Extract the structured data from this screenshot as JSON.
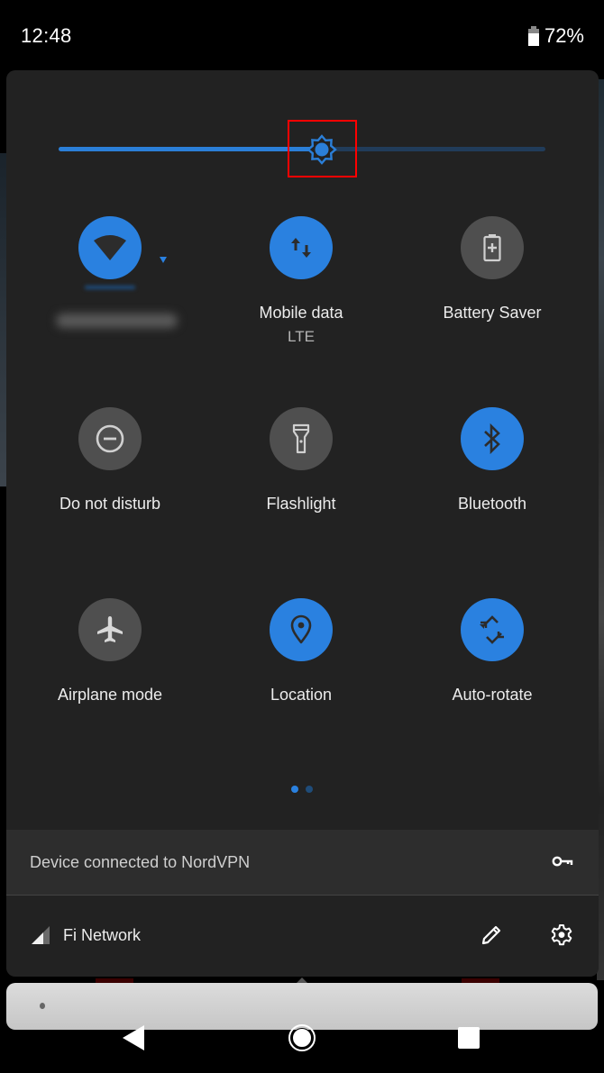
{
  "status_bar": {
    "time": "12:48",
    "battery_percent": "72%",
    "battery_level": 0.72
  },
  "brightness": {
    "level": 0.54,
    "highlighted": true
  },
  "colors": {
    "accent": "#2a81e0",
    "tile_off": "#4f4f4f",
    "panel_bg": "#222222"
  },
  "tiles": [
    {
      "id": "wifi",
      "label": "",
      "label_redacted": true,
      "state": "on",
      "icon": "wifi-icon",
      "has_dropdown": true
    },
    {
      "id": "mobile-data",
      "label": "Mobile data",
      "sublabel": "LTE",
      "state": "on",
      "icon": "mobile-data-icon"
    },
    {
      "id": "battery-saver",
      "label": "Battery Saver",
      "state": "off",
      "icon": "battery-saver-icon"
    },
    {
      "id": "do-not-disturb",
      "label": "Do not disturb",
      "state": "off",
      "icon": "do-not-disturb-icon"
    },
    {
      "id": "flashlight",
      "label": "Flashlight",
      "state": "off",
      "icon": "flashlight-icon"
    },
    {
      "id": "bluetooth",
      "label": "Bluetooth",
      "state": "on",
      "icon": "bluetooth-icon"
    },
    {
      "id": "airplane-mode",
      "label": "Airplane mode",
      "state": "off",
      "icon": "airplane-icon"
    },
    {
      "id": "location",
      "label": "Location",
      "state": "on",
      "icon": "location-icon"
    },
    {
      "id": "auto-rotate",
      "label": "Auto-rotate",
      "state": "on",
      "icon": "auto-rotate-icon"
    }
  ],
  "pager": {
    "current": 1,
    "total": 2
  },
  "vpn": {
    "text": "Device connected to NordVPN",
    "icon": "vpn-key-icon"
  },
  "network": {
    "label": "Fi Network",
    "icon": "cell-signal-icon"
  },
  "footer_actions": [
    {
      "id": "edit",
      "icon": "pencil-icon"
    },
    {
      "id": "settings",
      "icon": "gear-icon"
    }
  ],
  "nav": [
    "back",
    "home",
    "recents"
  ]
}
